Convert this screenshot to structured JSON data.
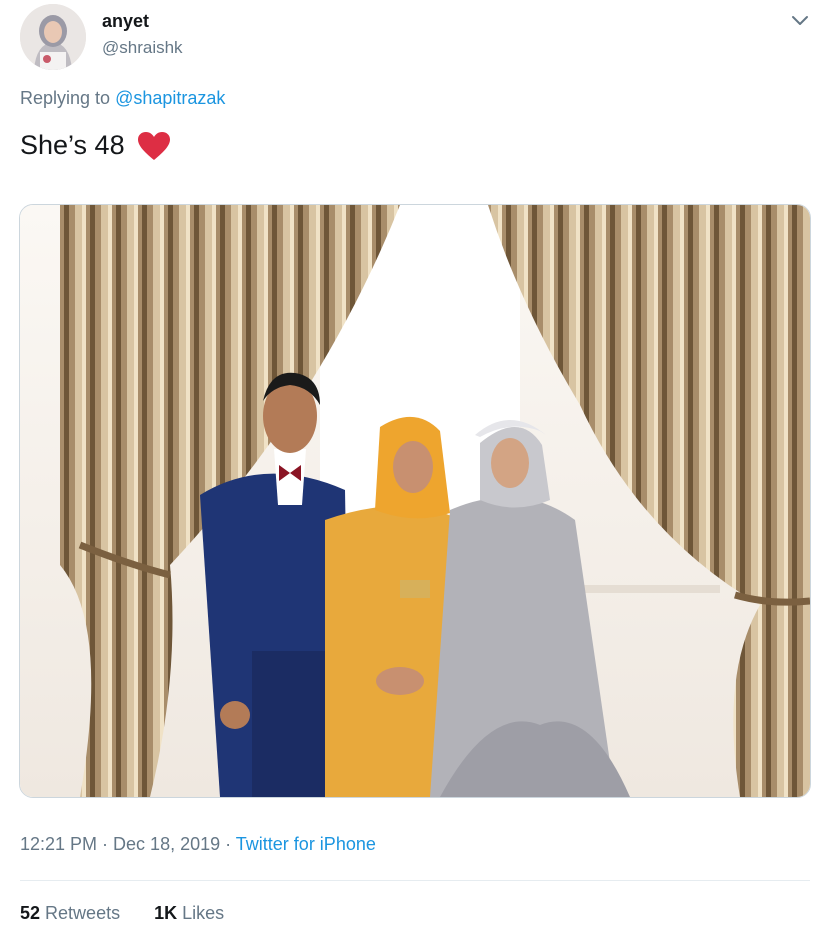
{
  "user": {
    "name": "anyet",
    "handle": "@shraishk"
  },
  "reply": {
    "prefix": "Replying to ",
    "mention": "@shapitrazak"
  },
  "tweet": {
    "text": "She’s 48",
    "emoji": "heart-icon"
  },
  "media": {
    "alt": "Photo of three people in formal attire standing in front of gold curtains"
  },
  "meta": {
    "time": "12:21 PM",
    "sep1": " · ",
    "date": "Dec 18, 2019",
    "sep2": " · ",
    "source": "Twitter for iPhone"
  },
  "stats": {
    "retweets_count": "52",
    "retweets_label": "Retweets",
    "likes_count": "1K",
    "likes_label": "Likes"
  },
  "colors": {
    "link": "#1b95e0",
    "secondary_text": "#657786",
    "heart": "#e0245e"
  }
}
